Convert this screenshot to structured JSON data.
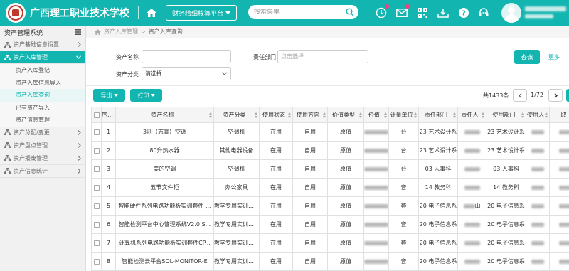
{
  "header": {
    "school_name": "广西理工职业技术学校",
    "platform_label": "财务精细核算平台",
    "search_placeholder": "搜索菜单"
  },
  "sidebar": {
    "title": "资产管理系统",
    "items": [
      {
        "label": "资产基础信息设置",
        "active": false
      },
      {
        "label": "资产入库管理",
        "active": true,
        "children": [
          "资产入库登记",
          "资产入库信息导入",
          "资产入库查询",
          "已有资产导入",
          "资产信息管理"
        ],
        "current": "资产入库查询"
      },
      {
        "label": "资产分配/变更",
        "active": false
      },
      {
        "label": "资产盘点管理",
        "active": false
      },
      {
        "label": "资产报废管理",
        "active": false
      },
      {
        "label": "资产信息统计",
        "active": false
      }
    ]
  },
  "breadcrumb": [
    "资产入库管理",
    "资产入库查询"
  ],
  "filters": {
    "asset_name_label": "资产名称",
    "asset_name_value": "",
    "owner_dept_label": "责任部门",
    "owner_dept_placeholder": "点击选择",
    "category_label": "资产分类",
    "category_value": "请选择",
    "query_button": "查询",
    "more_link": "更多"
  },
  "toolbar": {
    "export_label": "导出",
    "print_label": "打印",
    "total_text": "共1433条",
    "page_text": "1/72"
  },
  "table": {
    "columns": [
      "序号",
      "资产名称",
      "资产分类",
      "使用状态",
      "使用方向",
      "价值类型",
      "价值",
      "计量单位",
      "责任部门",
      "责任人",
      "使用部门",
      "使用人",
      "取"
    ],
    "rows": [
      {
        "no": "1",
        "name": "3匹（志高）空调",
        "category": "空调机",
        "status": "在用",
        "direction": "自用",
        "value_type": "原值",
        "unit": "台",
        "owner_dept": "23 艺术设计系",
        "use_dept": "23 艺术设计系"
      },
      {
        "no": "2",
        "name": "80升热水器",
        "category": "其他电器设备",
        "status": "在用",
        "direction": "自用",
        "value_type": "原值",
        "unit": "台",
        "owner_dept": "23 艺术设计系",
        "use_dept": "23 艺术设计系"
      },
      {
        "no": "3",
        "name": "美的空调",
        "category": "空调机",
        "status": "在用",
        "direction": "自用",
        "value_type": "原值",
        "unit": "台",
        "owner_dept": "03 人事科",
        "use_dept": "03 人事科"
      },
      {
        "no": "4",
        "name": "五节文件柜",
        "category": "办公家具",
        "status": "在用",
        "direction": "自用",
        "value_type": "原值",
        "unit": "套",
        "owner_dept": "14 教务科",
        "use_dept": "14 教务科"
      },
      {
        "no": "5",
        "name": "智能硬件系列电路功能板实训套件 ...",
        "category": "教学专用实训设备",
        "status": "在用",
        "direction": "自用",
        "value_type": "原值",
        "unit": "套",
        "owner_dept": "20 电子信息系",
        "owner_person_tail": "山",
        "use_dept": "20 电子信息系"
      },
      {
        "no": "6",
        "name": "智能检测平台中心管理系统V2.0 S...",
        "category": "教学专用实训设备",
        "status": "在用",
        "direction": "自用",
        "value_type": "原值",
        "unit": "套",
        "owner_dept": "20 电子信息系",
        "use_dept": "20 电子信息系"
      },
      {
        "no": "7",
        "name": "计算机系列电路功能板实训套件CP...",
        "category": "教学专用实训设备",
        "status": "在用",
        "direction": "自用",
        "value_type": "原值",
        "unit": "套",
        "owner_dept": "20 电子信息系",
        "use_dept": "20 电子信息系"
      },
      {
        "no": "8",
        "name": "智能检测云平台SOL-MONITOR-E",
        "category": "教学专用实训设备",
        "status": "在用",
        "direction": "自用",
        "value_type": "原值",
        "unit": "套",
        "owner_dept": "20 电子信息系",
        "use_dept": "20 电子信息系"
      }
    ]
  },
  "colors": {
    "accent": "#13b5b1",
    "notify_dot": "#ff3b7f",
    "logo_red": "#c0392b"
  },
  "icons": [
    "home-icon",
    "search-icon",
    "clock-icon",
    "mail-icon",
    "qrcode-icon",
    "download-icon",
    "help-icon",
    "headset-icon",
    "avatar-icon",
    "list-icon",
    "chevron-right-icon",
    "chevron-down-icon",
    "sitemap-icon"
  ]
}
